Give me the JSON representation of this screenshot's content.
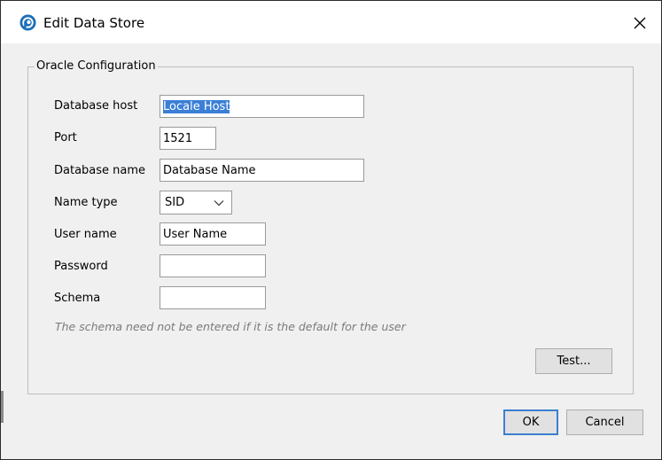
{
  "window": {
    "title": "Edit Data Store",
    "close_label": "×"
  },
  "group": {
    "legend": "Oracle Configuration"
  },
  "fields": {
    "database_host": {
      "label": "Database host",
      "value": "Locale Host"
    },
    "port": {
      "label": "Port",
      "value": "1521"
    },
    "database_name": {
      "label": "Database name",
      "value": "Database Name"
    },
    "name_type": {
      "label": "Name type",
      "value": "SID"
    },
    "user_name": {
      "label": "User name",
      "value": "User Name"
    },
    "password": {
      "label": "Password",
      "value": ""
    },
    "schema": {
      "label": "Schema",
      "value": ""
    }
  },
  "hint": "The schema need not be entered if it is the default for the user",
  "buttons": {
    "test": "Test...",
    "ok": "OK",
    "cancel": "Cancel"
  },
  "colors": {
    "accent": "#3c7fd1",
    "selection": "#3b7fd6"
  }
}
